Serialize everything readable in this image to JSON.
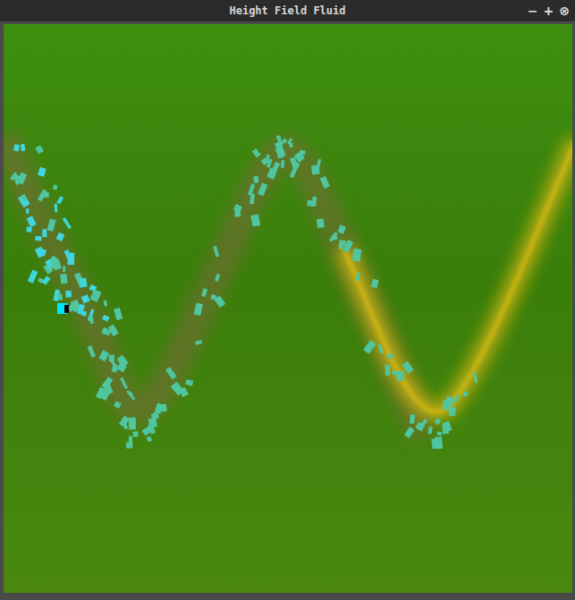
{
  "window": {
    "title": "Height Field Fluid",
    "controls": [
      {
        "name": "minimize",
        "glyph": "−"
      },
      {
        "name": "maximize",
        "glyph": "+"
      },
      {
        "name": "close",
        "glyph": "⊗"
      }
    ]
  }
}
